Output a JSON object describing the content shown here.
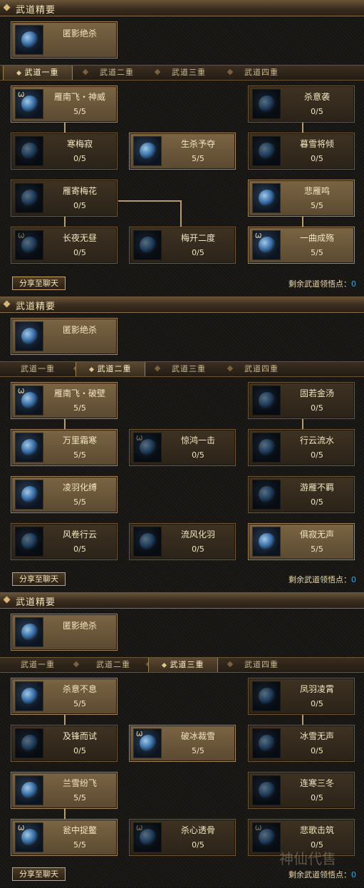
{
  "share_label": "分享至聊天",
  "remain_label": "剩余武道领悟点：",
  "remain_value": "0",
  "essentials_title": "武道精要",
  "tabs": [
    "武道一重",
    "武道二重",
    "武道三重",
    "武道四重"
  ],
  "sections": [
    {
      "active_tab": 0,
      "essential": {
        "name": "匿影绝杀"
      },
      "skills": [
        {
          "name": "雁南飞・神威",
          "count": "5/5",
          "lit": true
        },
        {
          "name": "杀意袭",
          "count": "0/5",
          "lit": false
        },
        {
          "name": "寒梅寂",
          "count": "0/5",
          "lit": false
        },
        {
          "name": "生杀予夺",
          "count": "5/5",
          "lit": true
        },
        {
          "name": "暮雪将倾",
          "count": "0/5",
          "lit": false
        },
        {
          "name": "雁寄梅花",
          "count": "0/5",
          "lit": false
        },
        {
          "name": "悲雁鸣",
          "count": "5/5",
          "lit": true
        },
        {
          "name": "长夜无昼",
          "count": "0/5",
          "lit": false
        },
        {
          "name": "梅开二度",
          "count": "0/5",
          "lit": false
        },
        {
          "name": "一曲成殇",
          "count": "5/5",
          "lit": true
        }
      ]
    },
    {
      "active_tab": 1,
      "essential": {
        "name": "匿影绝杀"
      },
      "skills": [
        {
          "name": "雁南飞・破壁",
          "count": "5/5",
          "lit": true
        },
        {
          "name": "固若金汤",
          "count": "0/5",
          "lit": false
        },
        {
          "name": "万里霜寒",
          "count": "5/5",
          "lit": true
        },
        {
          "name": "惊鸿一击",
          "count": "0/5",
          "lit": false
        },
        {
          "name": "行云流水",
          "count": "0/5",
          "lit": false
        },
        {
          "name": "凌羽化缚",
          "count": "5/5",
          "lit": true
        },
        {
          "name": "游雁不羁",
          "count": "0/5",
          "lit": false
        },
        {
          "name": "风卷行云",
          "count": "0/5",
          "lit": false
        },
        {
          "name": "流风化羽",
          "count": "0/5",
          "lit": false
        },
        {
          "name": "俱寂无声",
          "count": "5/5",
          "lit": true
        }
      ]
    },
    {
      "active_tab": 2,
      "essential": {
        "name": "匿影绝杀"
      },
      "skills": [
        {
          "name": "杀意不息",
          "count": "5/5",
          "lit": true
        },
        {
          "name": "凤羽凌霄",
          "count": "0/5",
          "lit": false
        },
        {
          "name": "及锋而试",
          "count": "0/5",
          "lit": false
        },
        {
          "name": "破冰裁雪",
          "count": "5/5",
          "lit": true
        },
        {
          "name": "冰雪无声",
          "count": "0/5",
          "lit": false
        },
        {
          "name": "兰雪纷飞",
          "count": "5/5",
          "lit": true
        },
        {
          "name": "连寒三冬",
          "count": "0/5",
          "lit": false
        },
        {
          "name": "瓮中捉鳖",
          "count": "5/5",
          "lit": true
        },
        {
          "name": "杀心透骨",
          "count": "0/5",
          "lit": false
        },
        {
          "name": "悲歌击筑",
          "count": "0/5",
          "lit": false
        }
      ]
    }
  ],
  "watermark": "神仙代售"
}
